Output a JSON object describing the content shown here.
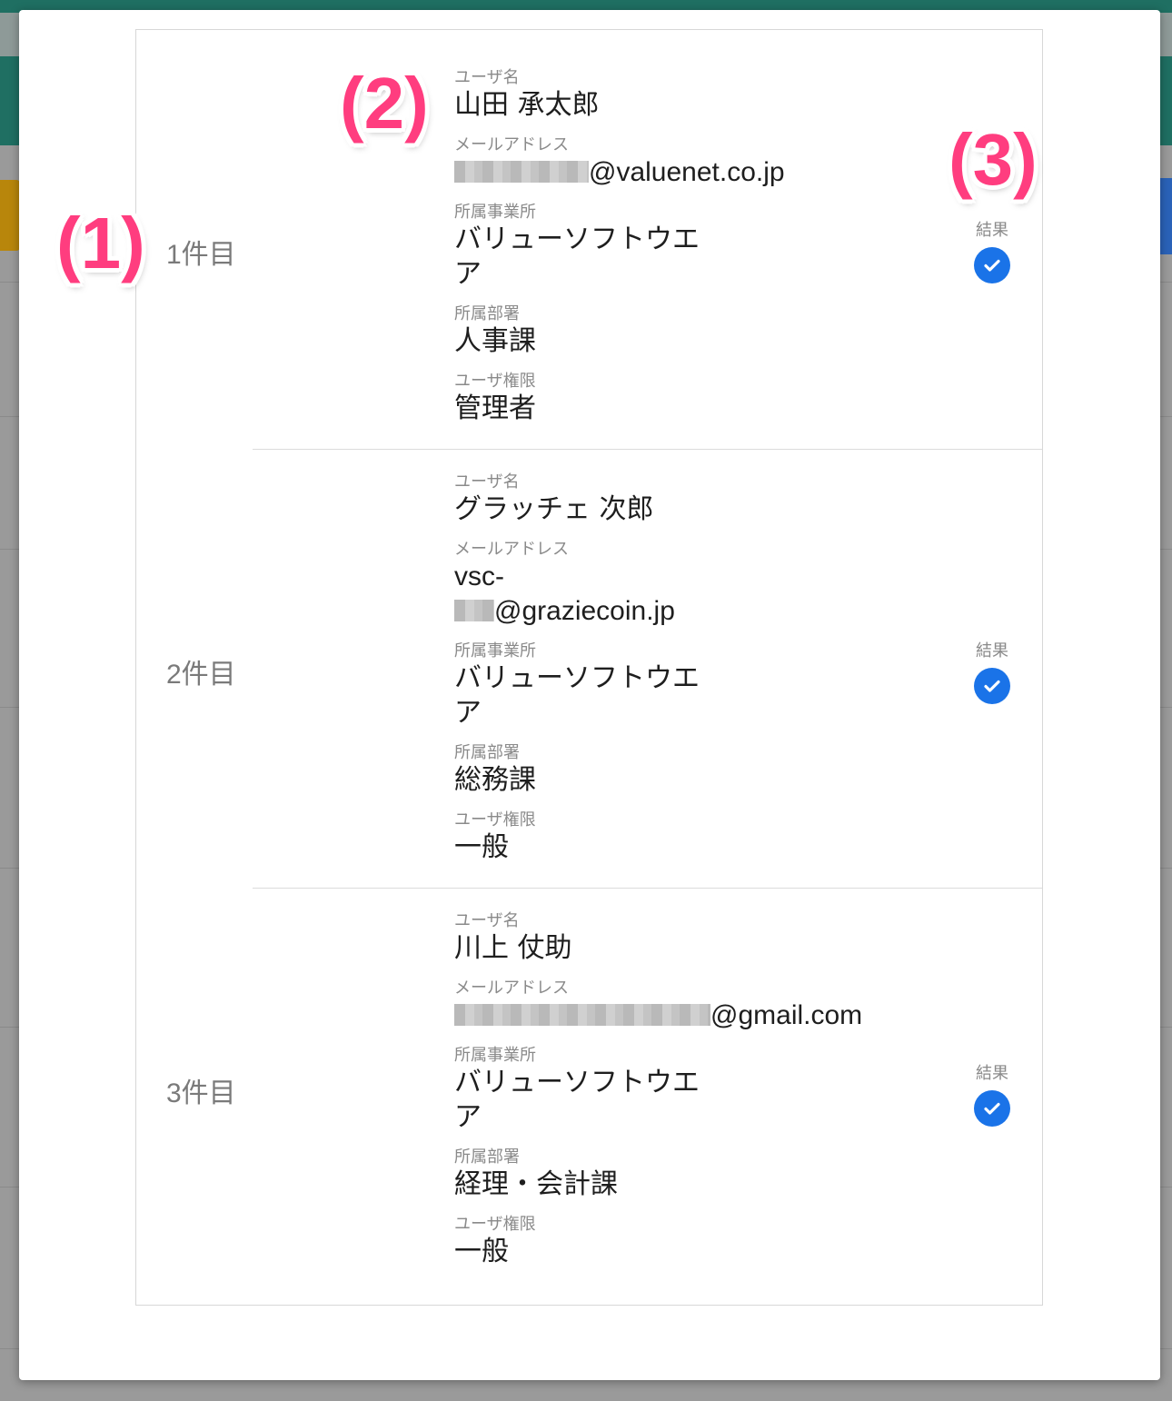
{
  "rows": [
    {
      "index_label": "1件目",
      "fields": {
        "username_label": "ユーザ名",
        "username": "山田 承太郎",
        "email_label": "メールアドレス",
        "email_domain": "@valuenet.co.jp",
        "office_label": "所属事業所",
        "office_line1": "バリューソフトウエ",
        "office_line2": "ア",
        "dept_label": "所属部署",
        "dept": "人事課",
        "role_label": "ユーザ権限",
        "role": "管理者"
      },
      "result_label": "結果"
    },
    {
      "index_label": "2件目",
      "fields": {
        "username_label": "ユーザ名",
        "username": "グラッチェ 次郎",
        "email_label": "メールアドレス",
        "email_prefix": "vsc-",
        "email_domain": "@graziecoin.jp",
        "office_label": "所属事業所",
        "office_line1": "バリューソフトウエ",
        "office_line2": "ア",
        "dept_label": "所属部署",
        "dept": "総務課",
        "role_label": "ユーザ権限",
        "role": "一般"
      },
      "result_label": "結果"
    },
    {
      "index_label": "3件目",
      "fields": {
        "username_label": "ユーザ名",
        "username": "川上 仗助",
        "email_label": "メールアドレス",
        "email_domain": "@gmail.com",
        "office_label": "所属事業所",
        "office_line1": "バリューソフトウエ",
        "office_line2": "ア",
        "dept_label": "所属部署",
        "dept": "経理・会計課",
        "role_label": "ユーザ権限",
        "role": "一般"
      },
      "result_label": "結果"
    }
  ],
  "annotations": [
    "(1)",
    "(2)",
    "(3)"
  ],
  "colors": {
    "accent": "#1a73e8",
    "annotation": "#ff3d7f",
    "header": "#1f6f62"
  },
  "icons": {
    "result": "check-circle-icon"
  }
}
